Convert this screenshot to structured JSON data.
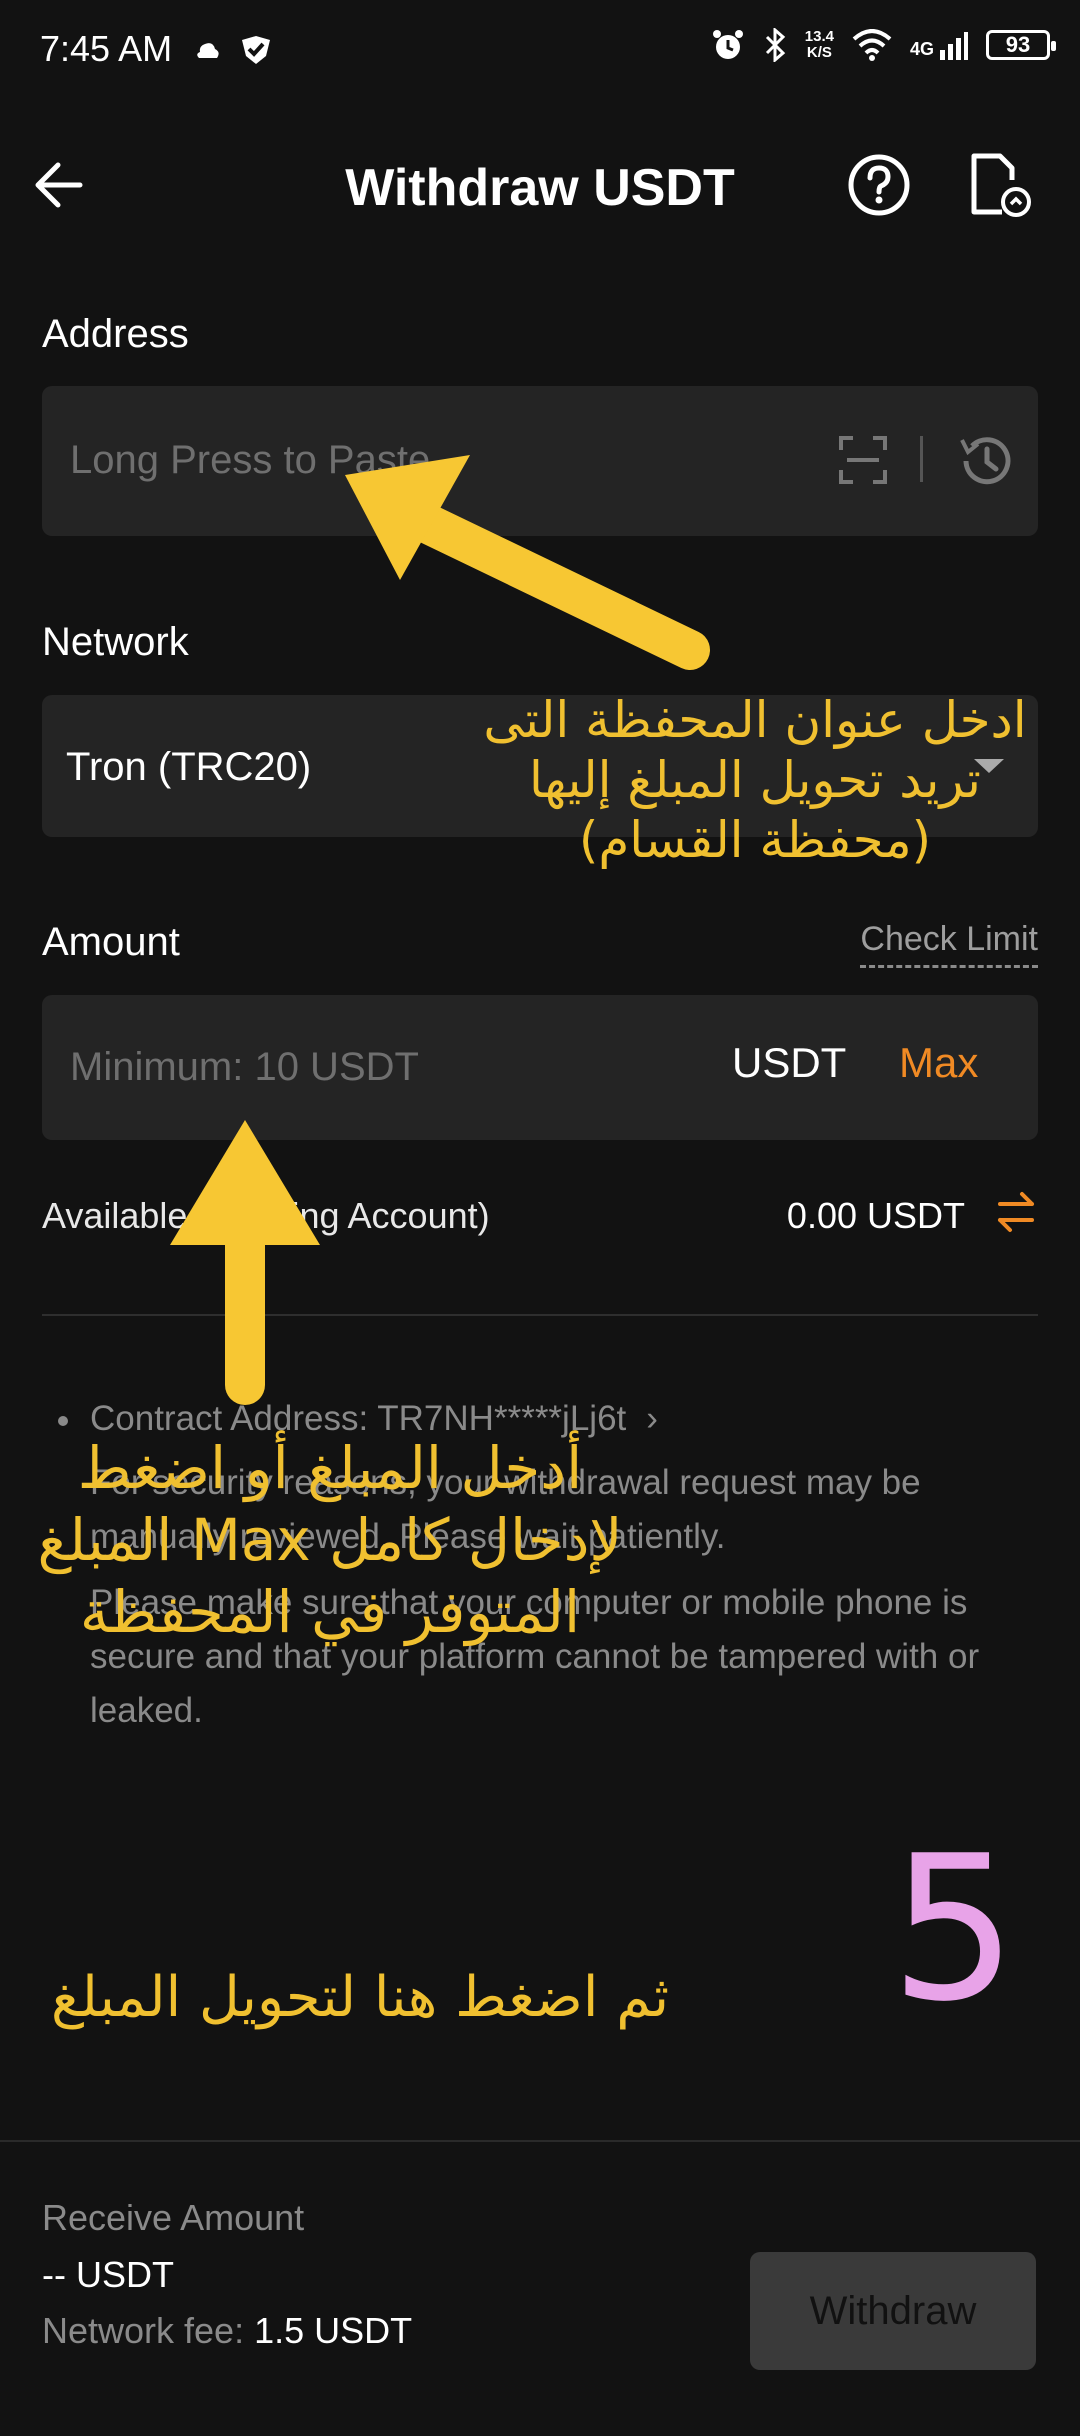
{
  "status_bar": {
    "time": "7:45 AM",
    "speed_value": "13.4",
    "speed_unit": "K/S",
    "network": "4G",
    "battery": "93"
  },
  "header": {
    "title": "Withdraw USDT"
  },
  "address": {
    "label": "Address",
    "placeholder": "Long Press to Paste"
  },
  "network": {
    "label": "Network",
    "selected": "Tron (TRC20)"
  },
  "amount": {
    "label": "Amount",
    "check_limit": "Check Limit",
    "placeholder": "Minimum: 10 USDT",
    "unit": "USDT",
    "max_label": "Max"
  },
  "available": {
    "label": "Available (Funding Account)",
    "value": "0.00 USDT"
  },
  "notes": [
    "Contract Address: TR7NH*****jLj6t",
    "For security reasons, your withdrawal request may be manually reviewed. Please wait patiently.",
    "Please make sure that your computer or mobile phone is secure and that your platform cannot be tampered with or leaked."
  ],
  "bottom": {
    "receive_label": "Receive Amount",
    "receive_value": "-- USDT",
    "fee_label": "Network fee:",
    "fee_value": "1.5 USDT",
    "withdraw_label": "Withdraw"
  },
  "annotations": {
    "address_hint": "ادخل عنوان المحفظة التى تريد تحويل المبلغ إليها (محفظة القسام)",
    "amount_hint": "أدخل المبلغ أو اضغط لإدخال كامل Max المبلغ المتوفر في المحفظة",
    "withdraw_hint": "ثم اضغط هنا لتحويل المبلغ",
    "step_number": "5"
  },
  "colors": {
    "background": "#121212",
    "field": "#242424",
    "accent_orange": "#f08a24",
    "annotation_yellow": "#f7c733",
    "step_pink": "#e8a3e8"
  },
  "icons": [
    "back-arrow-icon",
    "help-icon",
    "record-icon",
    "scan-icon",
    "history-icon",
    "dropdown-icon",
    "transfer-icon",
    "chevron-right-icon"
  ]
}
